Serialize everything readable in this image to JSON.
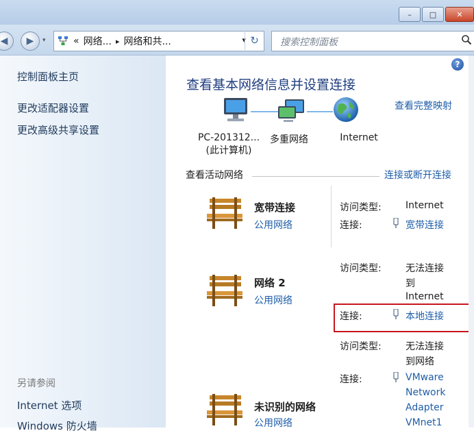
{
  "window": {
    "minimize_label": "–",
    "maximize_label": "□",
    "close_label": "✕"
  },
  "address": {
    "overflow": "«",
    "seg1": "网络...",
    "arrow": "▸",
    "seg2": "网络和共...",
    "dropdown": "▾",
    "refresh": "↻"
  },
  "search": {
    "placeholder": "搜索控制面板"
  },
  "sidebar": {
    "items": [
      "控制面板主页",
      "更改适配器设置",
      "更改高级共享设置"
    ],
    "see_also": "另请参阅",
    "see_also_items": [
      "Internet 选项",
      "Windows 防火墙"
    ]
  },
  "main": {
    "help": "?",
    "title": "查看基本网络信息并设置连接",
    "full_map": "查看完整映射",
    "map_nodes": [
      {
        "line1": "PC-201312...",
        "line2": "(此计算机)"
      },
      {
        "line1": "多重网络",
        "line2": ""
      },
      {
        "line1": "Internet",
        "line2": ""
      }
    ],
    "active_header": "查看活动网络",
    "connect_link": "连接或断开连接",
    "networks": [
      {
        "name": "宽带连接",
        "kind": "公用网络",
        "access_label": "访问类型:",
        "access_value": [
          "Internet"
        ],
        "conn_label": "连接:",
        "conn_value": [
          "宽带连接"
        ]
      },
      {
        "name": "网络 2",
        "kind": "公用网络",
        "access_label": "访问类型:",
        "access_value": [
          "无法连接",
          "到",
          "Internet"
        ],
        "conn_label": "连接:",
        "conn_value": [
          "本地连接"
        ]
      },
      {
        "name": "未识别的网络",
        "kind": "公用网络",
        "access_label": "访问类型:",
        "access_value": [
          "无法连接",
          "到网络"
        ],
        "conn_label": "连接:",
        "conn_value": [
          "VMware",
          "Network",
          "Adapter",
          "VMnet1"
        ]
      }
    ]
  }
}
